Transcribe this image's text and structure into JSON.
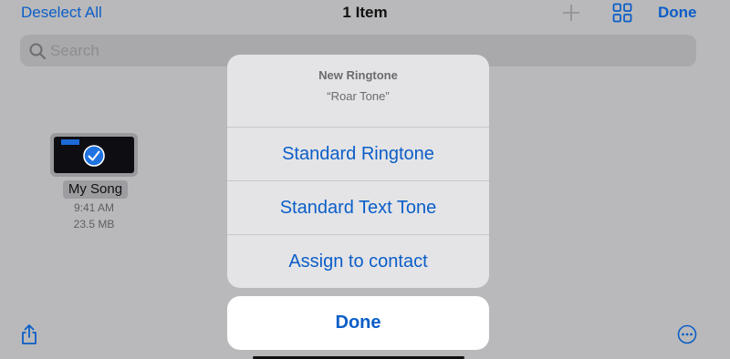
{
  "nav": {
    "left_label": "Deselect All",
    "title": "1 Item",
    "plus_icon": "plus-icon",
    "grid_icon": "grid-view-icon",
    "done_label": "Done"
  },
  "search": {
    "placeholder": "Search",
    "icon": "search-icon"
  },
  "file": {
    "name": "My Song",
    "time": "9:41 AM",
    "size": "23.5 MB",
    "selected": true
  },
  "toolbar": {
    "share_icon": "share-icon",
    "more_icon": "more-icon"
  },
  "action_sheet": {
    "title": "New Ringtone",
    "subtitle": "“Roar Tone”",
    "actions": [
      {
        "label": "Standard Ringtone"
      },
      {
        "label": "Standard Text Tone"
      },
      {
        "label": "Assign to contact"
      }
    ],
    "cancel_label": "Done"
  },
  "colors": {
    "accent": "#0b5ec8",
    "dimmed_background": "#b9b9bb",
    "sheet_background": "#e4e4e6"
  }
}
